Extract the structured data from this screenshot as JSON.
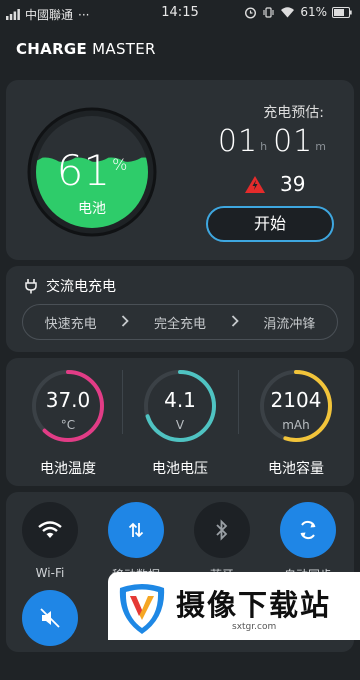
{
  "status_bar": {
    "carrier": "中國聯通",
    "dots": "···",
    "time": "14:15",
    "battery_pct": "61%"
  },
  "app": {
    "title_bold": "CHARGE",
    "title_rest": " MASTER"
  },
  "battery": {
    "percent": "61",
    "percent_sign": "%",
    "label": "电池",
    "level": 0.61,
    "fill_color": "#2ecc6a"
  },
  "estimate": {
    "label": "充电预估:",
    "hours": "01",
    "hours_unit": "h",
    "minutes": "01",
    "minutes_unit": "m",
    "warning_count": "39",
    "start_label": "开始"
  },
  "charge_mode": {
    "title": "交流电充电",
    "steps": [
      "快速充电",
      "完全充电",
      "涓流冲锋"
    ]
  },
  "stats": [
    {
      "value": "37.0",
      "unit": "°C",
      "label": "电池温度",
      "color": "#e23c86",
      "fraction": 0.62
    },
    {
      "value": "4.1",
      "unit": "V",
      "label": "电池电压",
      "color": "#4fc3c2",
      "fraction": 0.7
    },
    {
      "value": "2104",
      "unit": "mAh",
      "label": "电池容量",
      "color": "#f2c43a",
      "fraction": 0.55
    }
  ],
  "quick_settings": [
    {
      "name": "wifi",
      "label": "Wi-Fi",
      "state": "off",
      "icon": "wifi-icon"
    },
    {
      "name": "mobile-data",
      "label": "移动数据",
      "state": "on",
      "icon": "updown-arrows-icon"
    },
    {
      "name": "bluetooth",
      "label": "蓝牙",
      "state": "off",
      "icon": "bluetooth-icon"
    },
    {
      "name": "auto-sync",
      "label": "自动同步",
      "state": "on",
      "icon": "sync-icon"
    }
  ],
  "quick_settings_row2": [
    {
      "name": "sound",
      "state": "on",
      "icon": "mute-icon"
    }
  ],
  "banner": {
    "title": "摄像下载站",
    "url": "sxtgr.com"
  }
}
